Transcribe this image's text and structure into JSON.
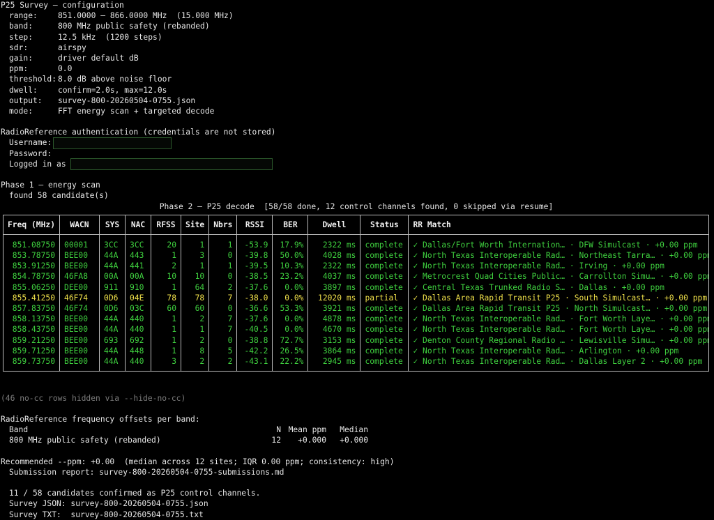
{
  "config": {
    "title": "P25 Survey — configuration",
    "rows": [
      {
        "key": "range:",
        "value": "851.0000 – 866.0000 MHz  (15.000 MHz)"
      },
      {
        "key": "band:",
        "value": "800 MHz public safety (rebanded)"
      },
      {
        "key": "step:",
        "value": "12.5 kHz  (1200 steps)"
      },
      {
        "key": "sdr:",
        "value": "airspy"
      },
      {
        "key": "gain:",
        "value": "driver default dB"
      },
      {
        "key": "ppm:",
        "value": "0.0"
      },
      {
        "key": "threshold:",
        "value": "8.0 dB above noise floor"
      },
      {
        "key": "dwell:",
        "value": "confirm=2.0s, max=12.0s"
      },
      {
        "key": "output:",
        "value": "survey-800-20260504-0755.json"
      },
      {
        "key": "mode:",
        "value": "FFT energy scan + targeted decode"
      }
    ]
  },
  "auth": {
    "title": "RadioReference authentication (credentials are not stored)",
    "username_label": "Username:",
    "username_value": "",
    "password_label": "Password:",
    "logged_in_label": "Logged in as",
    "logged_in_value": ""
  },
  "phase1": {
    "title": "Phase 1 — energy scan",
    "found": "found 58 candidate(s)"
  },
  "phase2": {
    "title": "Phase 2 — P25 decode  [58/58 done, 12 control channels found, 0 skipped via resume]"
  },
  "table": {
    "headers": [
      "Freq (MHz)",
      "WACN",
      "SYS",
      "NAC",
      "RFSS",
      "Site",
      "Nbrs",
      "RSSI",
      "BER",
      "Dwell",
      "Status",
      "RR Match"
    ],
    "rows": [
      {
        "state": "ok",
        "cells": [
          "851.08750",
          "00001",
          "3CC",
          "3CC",
          "20",
          "1",
          "1",
          "-53.9",
          "17.9%",
          "2322 ms",
          "complete",
          "✓ Dallas/Fort Worth Internation… · DFW Simulcast · +0.00 ppm"
        ]
      },
      {
        "state": "ok",
        "cells": [
          "853.78750",
          "BEE00",
          "44A",
          "443",
          "1",
          "3",
          "0",
          "-39.8",
          "50.0%",
          "4028 ms",
          "complete",
          "✓ North Texas Interoperable Rad… · Northeast Tarra… · +0.00 ppm"
        ]
      },
      {
        "state": "ok",
        "cells": [
          "853.91250",
          "BEE00",
          "44A",
          "441",
          "2",
          "1",
          "1",
          "-39.5",
          "10.3%",
          "2322 ms",
          "complete",
          "✓ North Texas Interoperable Rad… · Irving · +0.00 ppm"
        ]
      },
      {
        "state": "ok",
        "cells": [
          "854.78750",
          "46FA8",
          "00A",
          "00A",
          "10",
          "10",
          "0",
          "-38.5",
          "23.2%",
          "4037 ms",
          "complete",
          "✓ Metrocrest Quad Cities Public… · Carrollton Simu… · +0.00 ppm"
        ]
      },
      {
        "state": "ok",
        "cells": [
          "855.06250",
          "DEE00",
          "911",
          "910",
          "1",
          "64",
          "2",
          "-37.6",
          "0.0%",
          "3897 ms",
          "complete",
          "✓ Central Texas Trunked Radio S… · Dallas · +0.00 ppm"
        ]
      },
      {
        "state": "partial",
        "cells": [
          "855.41250",
          "46F74",
          "0D6",
          "04E",
          "78",
          "78",
          "7",
          "-38.0",
          "0.0%",
          "12020 ms",
          "partial",
          "✓ Dallas Area Rapid Transit P25 · South Simulcast… · +0.00 ppm"
        ]
      },
      {
        "state": "ok",
        "cells": [
          "857.83750",
          "46F74",
          "0D6",
          "03C",
          "60",
          "60",
          "0",
          "-36.6",
          "53.3%",
          "3921 ms",
          "complete",
          "✓ Dallas Area Rapid Transit P25 · North Simulcast… · +0.00 ppm"
        ]
      },
      {
        "state": "ok",
        "cells": [
          "858.13750",
          "BEE00",
          "44A",
          "440",
          "1",
          "2",
          "7",
          "-37.6",
          "0.0%",
          "4878 ms",
          "complete",
          "✓ North Texas Interoperable Rad… · Fort Worth Laye… · +0.00 ppm"
        ]
      },
      {
        "state": "ok",
        "cells": [
          "858.43750",
          "BEE00",
          "44A",
          "440",
          "1",
          "1",
          "7",
          "-40.5",
          "0.0%",
          "4670 ms",
          "complete",
          "✓ North Texas Interoperable Rad… · Fort Worth Laye… · +0.00 ppm"
        ]
      },
      {
        "state": "ok",
        "cells": [
          "859.21250",
          "BEE00",
          "693",
          "692",
          "1",
          "2",
          "0",
          "-38.8",
          "72.7%",
          "3153 ms",
          "complete",
          "✓ Denton County Regional Radio … · Lewisville Simu… · +0.00 ppm"
        ]
      },
      {
        "state": "ok",
        "cells": [
          "859.71250",
          "BEE00",
          "44A",
          "448",
          "1",
          "8",
          "5",
          "-42.2",
          "26.5%",
          "3864 ms",
          "complete",
          "✓ North Texas Interoperable Rad… · Arlington · +0.00 ppm"
        ]
      },
      {
        "state": "ok",
        "cells": [
          "859.73750",
          "BEE00",
          "44A",
          "440",
          "3",
          "2",
          "2",
          "-43.1",
          "22.2%",
          "2945 ms",
          "complete",
          "✓ North Texas Interoperable Rad… · Dallas Layer 2 · +0.00 ppm"
        ]
      }
    ]
  },
  "hidden_note": "(46 no-cc rows hidden via --hide-no-cc)",
  "offsets": {
    "title": "RadioReference frequency offsets per band:",
    "header": {
      "band": "Band",
      "n": "N",
      "mean": "Mean ppm",
      "median": "Median"
    },
    "rows": [
      {
        "band": "800 MHz public safety (rebanded)",
        "n": "12",
        "mean": "+0.000",
        "median": "+0.000"
      }
    ]
  },
  "summary": {
    "recommended": "Recommended --ppm: +0.00  (median across 12 sites; IQR 0.00 ppm; consistency: high)",
    "submission": "Submission report: survey-800-20260504-0755-submissions.md",
    "confirmed": "11 / 58 candidates confirmed as P25 control channels.",
    "survey_json": "Survey JSON: survey-800-20260504-0755.json",
    "survey_txt": "Survey TXT:  survey-800-20260504-0755.txt"
  },
  "colors": {
    "background": "#000000",
    "text": "#e6e6e6",
    "complete_row": "#3fd13f",
    "partial_row": "#f0e14a",
    "muted": "#7d7d7d",
    "input_border": "#2c5a2c"
  }
}
